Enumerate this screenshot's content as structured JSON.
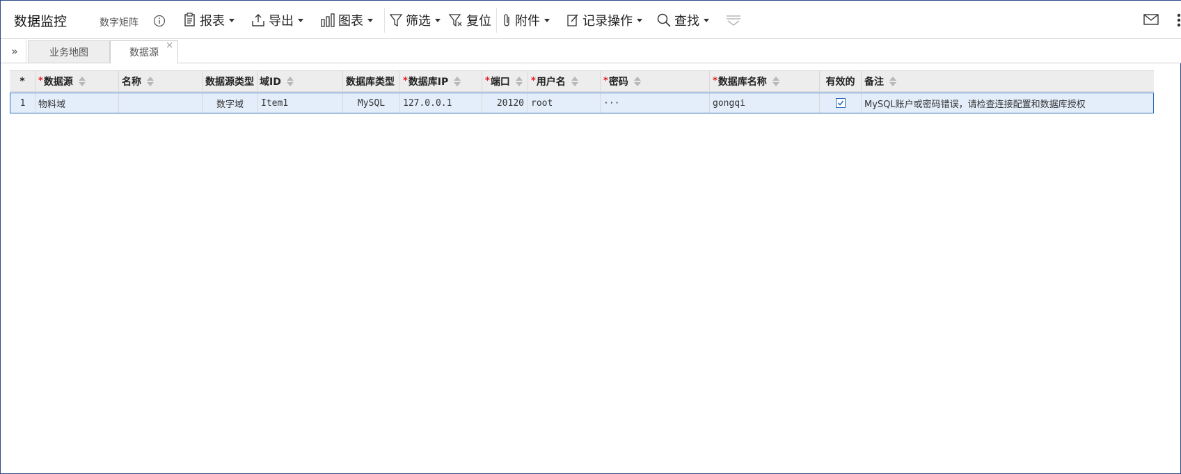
{
  "app": {
    "title": "数据监控",
    "subtitle": "数字矩阵"
  },
  "toolbar": {
    "report": "报表",
    "export": "导出",
    "chart": "图表",
    "filter": "筛选",
    "reset": "复位",
    "attachment": "附件",
    "record_ops": "记录操作",
    "search": "查找"
  },
  "tabs": [
    {
      "label": "业务地图",
      "active": false
    },
    {
      "label": "数据源",
      "active": true,
      "close": "×"
    }
  ],
  "grid": {
    "columns": [
      {
        "label": "*",
        "required": false,
        "sortable": false
      },
      {
        "label": "数据源",
        "required": true,
        "sortable": true
      },
      {
        "label": "名称",
        "required": false,
        "sortable": true
      },
      {
        "label": "数据源类型",
        "required": false,
        "sortable": false
      },
      {
        "label": "域ID",
        "required": false,
        "sortable": true
      },
      {
        "label": "数据库类型",
        "required": false,
        "sortable": false
      },
      {
        "label": "数据库IP",
        "required": true,
        "sortable": true
      },
      {
        "label": "端口",
        "required": true,
        "sortable": true
      },
      {
        "label": "用户名",
        "required": true,
        "sortable": true
      },
      {
        "label": "密码",
        "required": true,
        "sortable": true
      },
      {
        "label": "数据库名称",
        "required": true,
        "sortable": true
      },
      {
        "label": "有效的",
        "required": false,
        "sortable": false
      },
      {
        "label": "备注",
        "required": false,
        "sortable": true
      }
    ],
    "rows": [
      {
        "index": "1",
        "data_source": "物料域",
        "name": "",
        "source_type": "数字域",
        "domain_id": "Item1",
        "db_type": "MySQL",
        "db_ip": "127.0.0.1",
        "port": "20120",
        "username": "root",
        "password": "···",
        "db_name": "gongqi",
        "valid": true,
        "remark": "MySQL账户或密码错误，请检查连接配置和数据库授权"
      }
    ]
  },
  "colors": {
    "required": "#e02020",
    "selected_row_bg": "#e4eefa",
    "selected_row_border": "#2e6db5",
    "header_bg": "#ededed"
  }
}
